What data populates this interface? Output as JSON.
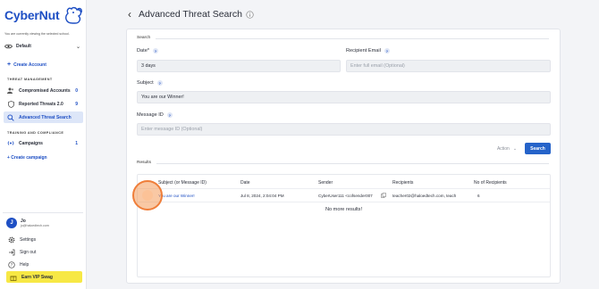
{
  "app": {
    "logo_text": "CyberNut",
    "viewing_note": "You are currently viewing the selected school.",
    "school_select": "Default"
  },
  "sidebar": {
    "create_account": "Create Account",
    "section_threat": "THREAT MANAGEMENT",
    "items": [
      {
        "label": "Compromised Accounts",
        "count": "0",
        "icon": "users-icon"
      },
      {
        "label": "Reported Threats 2.0",
        "count": "9",
        "icon": "shield-icon"
      },
      {
        "label": "Advanced Threat Search",
        "count": "",
        "icon": "search-icon"
      }
    ],
    "section_training": "TRAINING AND COMPLIANCE",
    "campaigns": {
      "label": "Campaigns",
      "count": "1"
    },
    "create_campaign": "+ Create campaign"
  },
  "user": {
    "initial": "J",
    "name": "Jo",
    "email": "jo@haloedtech.com"
  },
  "bottom_menu": {
    "settings": "Settings",
    "sign_out": "Sign out",
    "help": "Help",
    "swag": "Earn VIP Swag"
  },
  "header": {
    "title": "Advanced Threat Search"
  },
  "search": {
    "legend": "Search",
    "date_label": "Date*",
    "date_value": "3 days",
    "recipient_label": "Recipient Email",
    "recipient_placeholder": "Enter full email (Optional)",
    "subject_label": "Subject",
    "subject_value": "You are our Winner!",
    "message_id_label": "Message ID",
    "message_id_placeholder": "Enter message ID (Optional)",
    "action_label": "Action",
    "search_button": "Search"
  },
  "results": {
    "legend": "Results",
    "columns": [
      "Subject (or Message ID)",
      "Date",
      "Sender",
      "Recipients",
      "No of Recipients"
    ],
    "rows": [
      {
        "subject": "You are our Winner!",
        "date": "Jul 8, 2024, 2:04:04 PM",
        "sender": "CyberUser111 <cofsender007",
        "recipients": "teacher02@haloedtech.com, teach",
        "count": "6"
      }
    ],
    "no_more": "No more results!"
  },
  "colors": {
    "brand": "#1e4fc4",
    "primary_button": "#2563c9",
    "active_nav": "#dde6f8",
    "swag": "#f7e845",
    "click_marker": "#ef7e3a"
  }
}
